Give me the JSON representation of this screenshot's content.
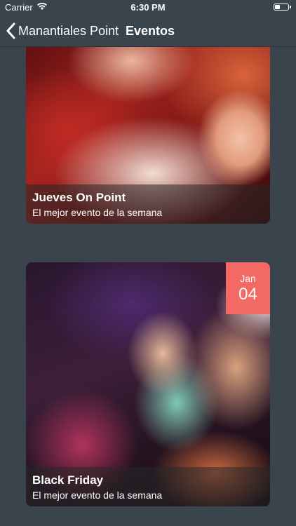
{
  "status_bar": {
    "carrier": "Carrier",
    "time": "6:30 PM",
    "wifi_icon": "wifi-icon",
    "battery_icon": "battery-icon"
  },
  "nav": {
    "back_icon": "chevron-left-icon",
    "back_label": "Manantiales Point",
    "title": "Eventos"
  },
  "events": [
    {
      "title": "Jueves On Point",
      "subtitle": "El mejor evento de la semana"
    },
    {
      "title": "Black Friday",
      "subtitle": "El mejor evento de la semana",
      "date": {
        "month": "Jan",
        "day": "04"
      }
    }
  ],
  "colors": {
    "background": "#3a444d",
    "date_badge": "#f26a63",
    "text": "#ffffff"
  }
}
